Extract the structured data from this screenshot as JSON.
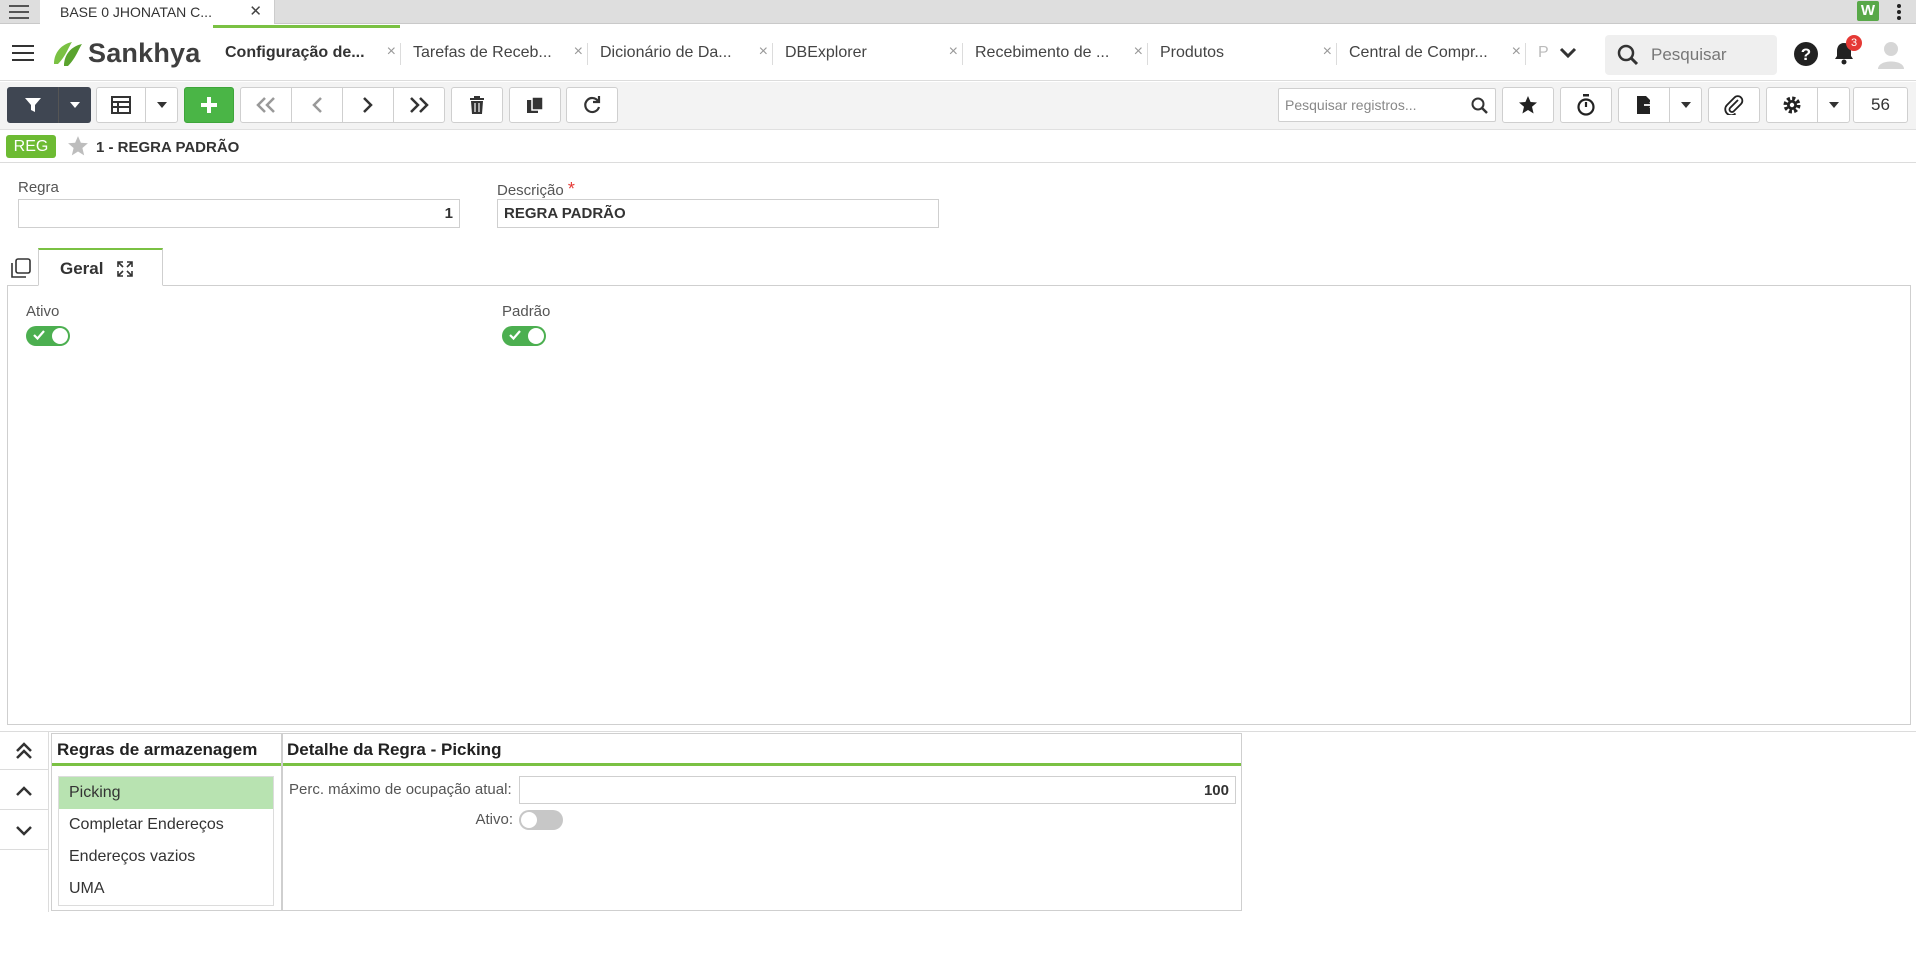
{
  "browser": {
    "tab_title": "BASE 0 JHONATAN C...",
    "tab_close": "✕",
    "extension_label": "W"
  },
  "header": {
    "brand": "Sankhya",
    "tabs": [
      {
        "label": "Configuração de...",
        "active": true
      },
      {
        "label": "Tarefas de Receb...",
        "active": false
      },
      {
        "label": "Dicionário de Da...",
        "active": false
      },
      {
        "label": "DBExplorer",
        "active": false
      },
      {
        "label": "Recebimento de ...",
        "active": false
      },
      {
        "label": "Produtos",
        "active": false
      },
      {
        "label": "Central de Compr...",
        "active": false
      },
      {
        "label": "P",
        "active": false
      }
    ],
    "close_glyph": "×",
    "search_placeholder": "Pesquisar",
    "notification_count": "3"
  },
  "toolbar": {
    "search_placeholder": "Pesquisar registros...",
    "record_count": "56"
  },
  "record": {
    "tag": "REG",
    "title": "1 - REGRA PADRÃO"
  },
  "form": {
    "regra_label": "Regra",
    "regra_value": "1",
    "descricao_label": "Descrição",
    "required_mark": "*",
    "descricao_value": "REGRA PADRÃO",
    "tab_label": "Geral",
    "ativo_label": "Ativo",
    "ativo_on": true,
    "padrao_label": "Padrão",
    "padrao_on": true
  },
  "rules": {
    "title": "Regras de armazenagem",
    "items": [
      "Picking",
      "Completar Endereços",
      "Endereços vazios",
      "UMA"
    ],
    "selected": "Picking"
  },
  "detail": {
    "title": "Detalhe da Regra - Picking",
    "perc_label": "Perc. máximo de ocupação atual:",
    "perc_value": "100",
    "ativo_label": "Ativo:",
    "ativo_on": false
  },
  "colors": {
    "accent": "#7ac143",
    "toggle_on": "#4caf50",
    "selected_row": "#b8e3b1",
    "dark_button": "#3f4652",
    "add_button": "#4ab546"
  }
}
